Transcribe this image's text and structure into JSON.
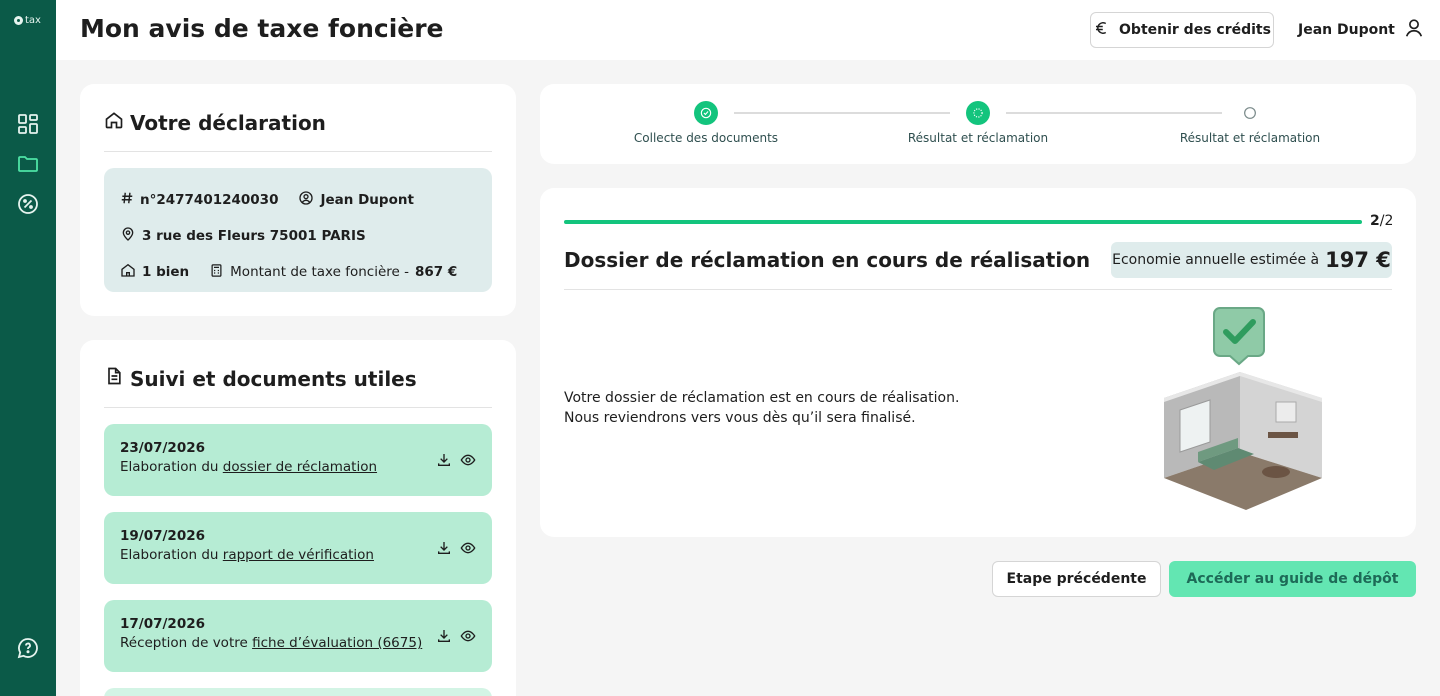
{
  "app": {
    "logo_text": "tax"
  },
  "header": {
    "title": "Mon avis de taxe foncière",
    "credits_label": "Obtenir des crédits",
    "user_name": "Jean Dupont"
  },
  "declaration": {
    "title": "Votre déclaration",
    "number": "n°2477401240030",
    "owner": "Jean Dupont",
    "address": "3 rue des Fleurs 75001 PARIS",
    "properties": "1 bien",
    "tax_label": "Montant de taxe foncière -",
    "tax_amount": "867 €"
  },
  "documents": {
    "title": "Suivi et documents utiles",
    "items": [
      {
        "date": "23/07/2026",
        "prefix": "Elaboration du",
        "link": "dossier de réclamation"
      },
      {
        "date": "19/07/2026",
        "prefix": "Elaboration du",
        "link": "rapport de vérification"
      },
      {
        "date": "17/07/2026",
        "prefix": "Réception de votre",
        "link": "fiche d’évaluation (6675)"
      }
    ]
  },
  "stepper": {
    "steps": [
      {
        "label": "Collecte des documents",
        "state": "done"
      },
      {
        "label": "Résultat et réclamation",
        "state": "active"
      },
      {
        "label": "Résultat et réclamation",
        "state": "pending"
      }
    ]
  },
  "claim": {
    "progress_current": "2",
    "progress_total": "/2",
    "progress_fraction": 1.0,
    "title": "Dossier de réclamation en cours de réalisation",
    "savings_label": "Economie annuelle estimée à",
    "savings_value": "197 €",
    "text_line1": "Votre dossier de réclamation est en cours de réalisation.",
    "text_line2": "Nous reviendrons vers vous dès qu’il sera finalisé."
  },
  "actions": {
    "previous_label": "Etape précédente",
    "guide_label": "Accéder au guide de dépôt"
  },
  "colors": {
    "sidebar": "#0b5a48",
    "accent": "#13c47d",
    "doc_bg": "#b6ecd4",
    "info_bg": "#dfecec"
  }
}
